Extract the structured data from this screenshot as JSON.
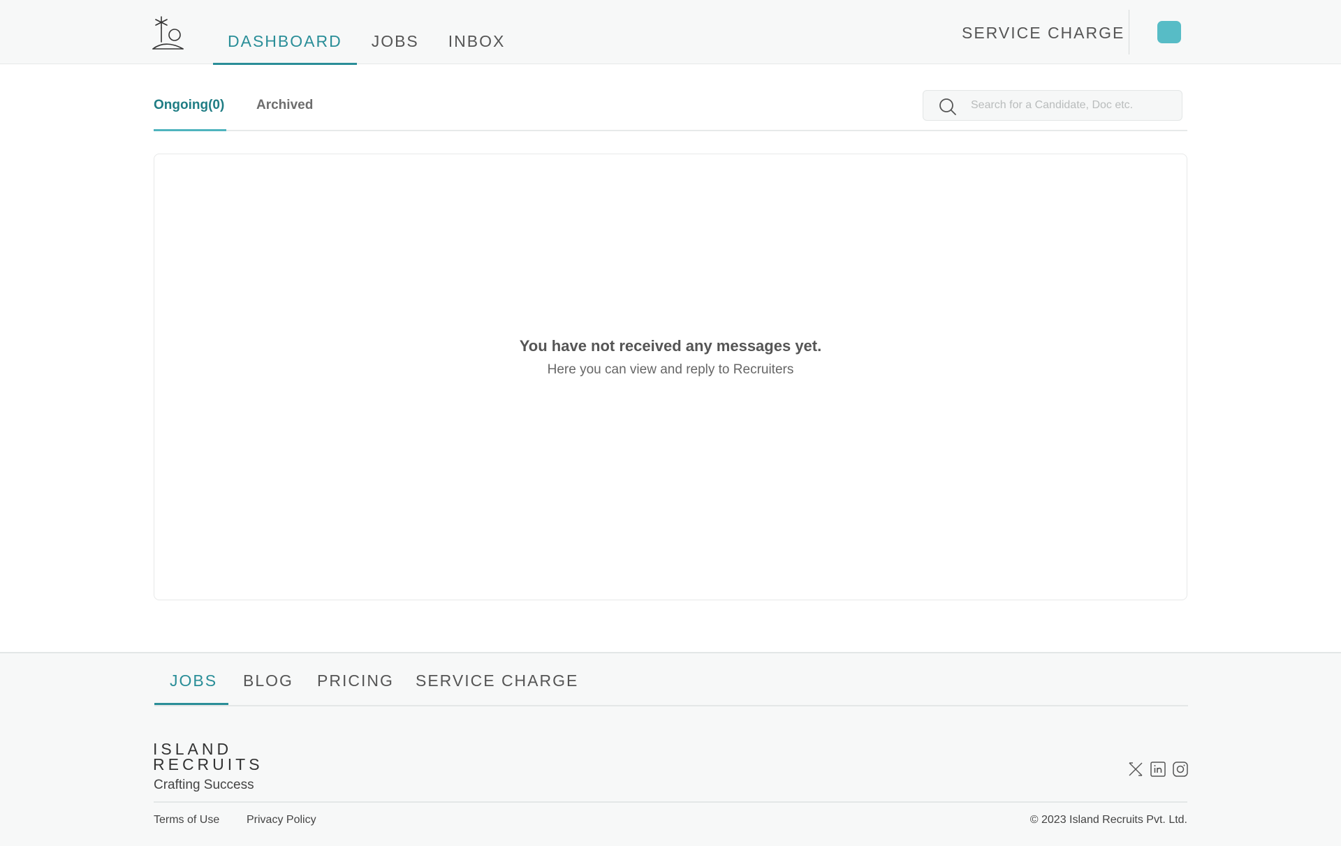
{
  "header": {
    "nav": [
      {
        "label": "DASHBOARD",
        "active": true
      },
      {
        "label": "JOBS",
        "active": false
      },
      {
        "label": "INBOX",
        "active": false
      }
    ],
    "service_charge": "SERVICE CHARGE"
  },
  "tabs": {
    "ongoing": "Ongoing(0)",
    "archived": "Archived"
  },
  "search": {
    "placeholder": "Search for a Candidate, Doc etc."
  },
  "empty_state": {
    "title": "You have not received any messages yet.",
    "subtitle": "Here you can view and reply to Recruiters"
  },
  "footer": {
    "nav": {
      "jobs": "JOBS",
      "blog": "BLOG",
      "pricing": "PRICING",
      "service_charge": "SERVICE CHARGE"
    },
    "brand_line1": "ISLAND",
    "brand_line2": "RECRUITS",
    "tagline": "Crafting Success",
    "terms": "Terms of Use",
    "privacy": "Privacy Policy",
    "copyright": "© 2023 Island Recruits Pvt. Ltd."
  },
  "colors": {
    "accent": "#2a8e98",
    "avatar": "#57bcc6",
    "header_bg": "#f7f8f8"
  },
  "icons": [
    "palm-island-logo-icon",
    "search-icon",
    "x-icon",
    "linkedin-icon",
    "instagram-icon"
  ]
}
